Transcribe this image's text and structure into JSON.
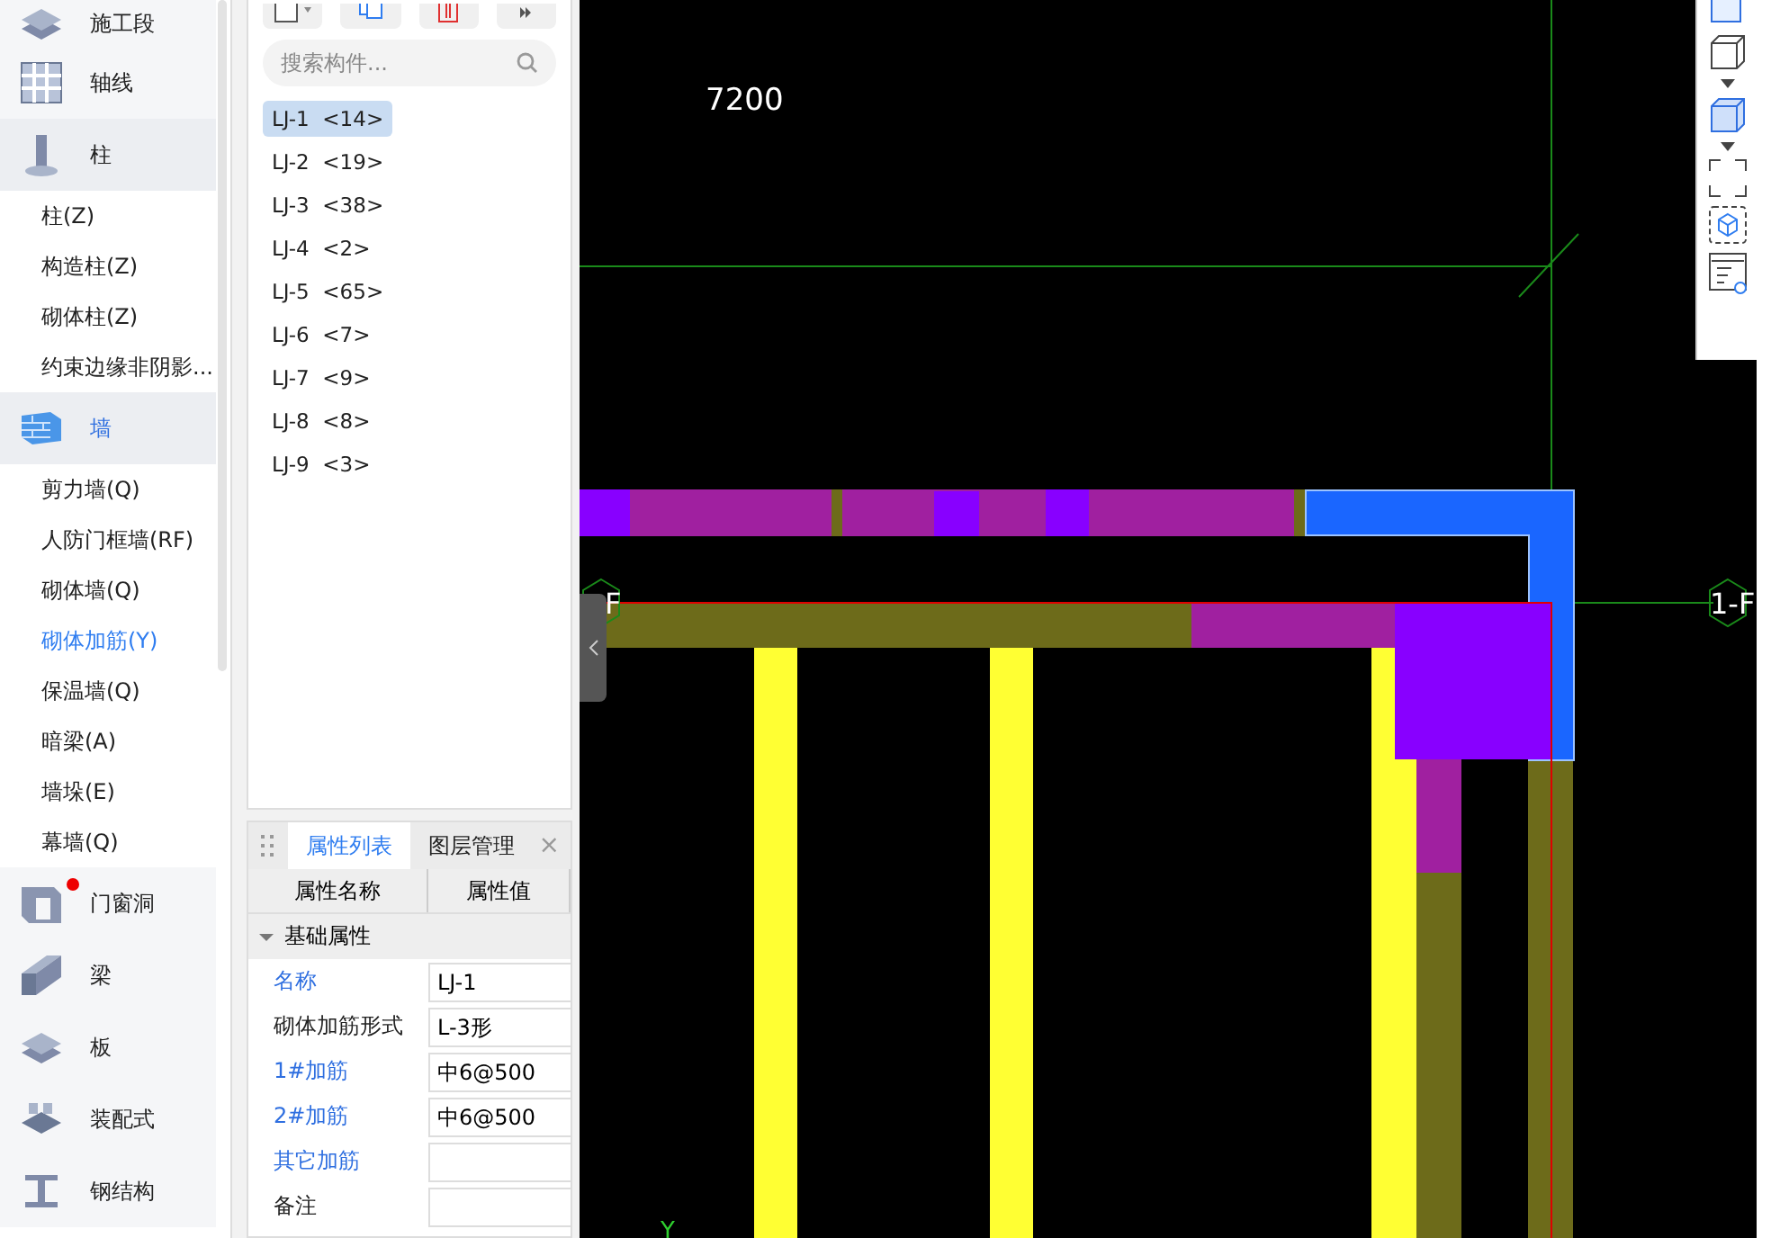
{
  "sidebar": {
    "items": [
      {
        "kind": "category",
        "label": "施工段",
        "selected": false,
        "badge": false
      },
      {
        "kind": "category",
        "label": "轴线",
        "selected": false,
        "badge": false
      },
      {
        "kind": "category",
        "label": "柱",
        "selected": false,
        "badge": false
      },
      {
        "kind": "item",
        "label": "柱(Z)",
        "selected": false
      },
      {
        "kind": "item",
        "label": "构造柱(Z)",
        "selected": false
      },
      {
        "kind": "item",
        "label": "砌体柱(Z)",
        "selected": false
      },
      {
        "kind": "item",
        "label": "约束边缘非阴影...",
        "selected": false
      },
      {
        "kind": "category",
        "label": "墙",
        "selected": true,
        "badge": false
      },
      {
        "kind": "item",
        "label": "剪力墙(Q)",
        "selected": false
      },
      {
        "kind": "item",
        "label": "人防门框墙(RF)",
        "selected": false
      },
      {
        "kind": "item",
        "label": "砌体墙(Q)",
        "selected": false
      },
      {
        "kind": "item",
        "label": "砌体加筋(Y)",
        "selected": true
      },
      {
        "kind": "item",
        "label": "保温墙(Q)",
        "selected": false
      },
      {
        "kind": "item",
        "label": "暗梁(A)",
        "selected": false
      },
      {
        "kind": "item",
        "label": "墙垛(E)",
        "selected": false
      },
      {
        "kind": "item",
        "label": "幕墙(Q)",
        "selected": false
      },
      {
        "kind": "category",
        "label": "门窗洞",
        "selected": false,
        "badge": true
      },
      {
        "kind": "category",
        "label": "梁",
        "selected": false,
        "badge": false
      },
      {
        "kind": "category",
        "label": "板",
        "selected": false,
        "badge": false
      },
      {
        "kind": "category",
        "label": "装配式",
        "selected": false,
        "badge": false
      },
      {
        "kind": "category",
        "label": "钢结构",
        "selected": false,
        "badge": false
      }
    ]
  },
  "components": {
    "search": {
      "placeholder": "搜索构件..."
    },
    "items": [
      {
        "name": "LJ-1",
        "count": "<14>",
        "selected": true
      },
      {
        "name": "LJ-2",
        "count": "<19>",
        "selected": false
      },
      {
        "name": "LJ-3",
        "count": "<38>",
        "selected": false
      },
      {
        "name": "LJ-4",
        "count": "<2>",
        "selected": false
      },
      {
        "name": "LJ-5",
        "count": "<65>",
        "selected": false
      },
      {
        "name": "LJ-6",
        "count": "<7>",
        "selected": false
      },
      {
        "name": "LJ-7",
        "count": "<9>",
        "selected": false
      },
      {
        "name": "LJ-8",
        "count": "<8>",
        "selected": false
      },
      {
        "name": "LJ-9",
        "count": "<3>",
        "selected": false
      }
    ]
  },
  "properties": {
    "tabs": [
      {
        "label": "属性列表",
        "selected": true
      },
      {
        "label": "图层管理",
        "selected": false
      }
    ],
    "close": "×",
    "columns": [
      "属性名称",
      "属性值"
    ],
    "group": {
      "label": "基础属性",
      "expanded": true
    },
    "rows": [
      {
        "name": "名称",
        "value": "LJ-1",
        "public": true
      },
      {
        "name": "砌体加筋形式",
        "value": "L-3形",
        "public": false
      },
      {
        "name": "1#加筋",
        "value": "中6@500",
        "public": true
      },
      {
        "name": "2#加筋",
        "value": "中6@500",
        "public": true
      },
      {
        "name": "其它加筋",
        "value": "",
        "public": true
      },
      {
        "name": "备注",
        "value": "",
        "public": false
      }
    ]
  },
  "canvas": {
    "dimension": "7200",
    "axis_left": "F",
    "axis_right": "1-F",
    "y_axis": "Y"
  }
}
